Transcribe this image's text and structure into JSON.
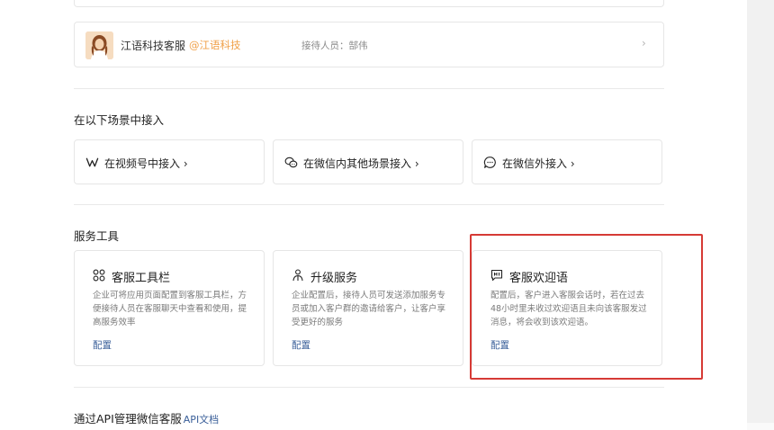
{
  "agent": {
    "name": "江语科技客服",
    "org": "@江语科技",
    "staff": "接待人员：郜伟",
    "chevron": "›"
  },
  "scenes": {
    "title": "在以下场景中接入",
    "items": [
      {
        "label": "在视频号中接入 ›",
        "icon": "channels-icon"
      },
      {
        "label": "在微信内其他场景接入 ›",
        "icon": "wechat-chat-icon"
      },
      {
        "label": "在微信外接入 ›",
        "icon": "speech-bubble-icon"
      }
    ]
  },
  "tools": {
    "title": "服务工具",
    "items": [
      {
        "title": "客服工具栏",
        "icon": "grid-icon",
        "desc": "企业可将应用页面配置到客服工具栏，方便接待人员在客服聊天中查看和使用，提高服务效率",
        "action": "配置"
      },
      {
        "title": "升级服务",
        "icon": "upgrade-person-icon",
        "desc": "企业配置后，接待人员可发送添加服务专员或加入客户群的邀请给客户，让客户享受更好的服务",
        "action": "配置"
      },
      {
        "title": "客服欢迎语",
        "icon": "welcome-message-icon",
        "desc": "配置后，客户进入客服会话时，若在过去48小时里未收过欢迎语且未向该客服发过消息，将会收到该欢迎语。",
        "action": "配置"
      }
    ]
  },
  "api": {
    "title": "通过API管理微信客服",
    "link": "API文档"
  },
  "colors": {
    "accent_link": "#3a5f99",
    "org_orange": "#f0a048",
    "highlight_red": "#d63a35"
  }
}
